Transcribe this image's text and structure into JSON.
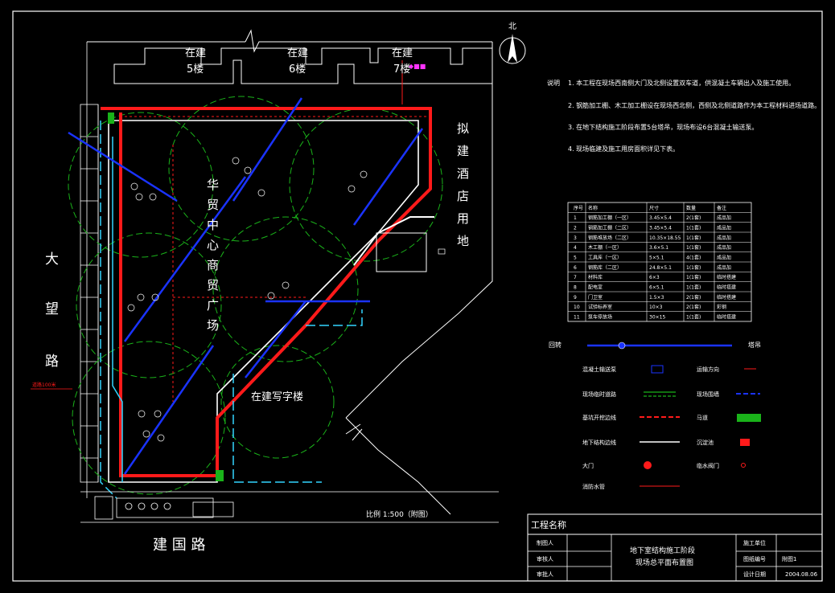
{
  "north_label": "北",
  "labels": {
    "bld5": [
      "在建",
      "5楼"
    ],
    "bld6": [
      "在建",
      "6楼"
    ],
    "bld7": [
      "在建",
      "7楼"
    ],
    "hotel": [
      "拟",
      "建",
      "酒",
      "店",
      "用",
      "地"
    ],
    "plaza": [
      "华",
      "贸",
      "中",
      "心",
      "商",
      "贸",
      "广",
      "场"
    ],
    "wangroad": [
      "大",
      "望",
      "路"
    ],
    "office": "在建写字楼",
    "jianguo": "建 国 路",
    "scale": "比例 1:500（附图）",
    "red_tag": "道路100米"
  },
  "notes": {
    "title": "说明",
    "items": [
      "1. 本工程在现场西南侧大门及北侧设置双车道，供混凝土车辆出入及施工使用。",
      "2. 钢筋加工棚、木工加工棚设在现场西北侧，西侧及北侧道路作为本工程材料进场道路。",
      "3. 在地下结构施工阶段布置5台塔吊，现场布设6台混凝土输送泵。",
      "4. 现场临建及施工用房面积详见下表。"
    ]
  },
  "table": {
    "headers": [
      "序号",
      "名称",
      "尺寸",
      "数量",
      "备注"
    ],
    "rows": [
      [
        "1",
        "钢筋加工棚（一区）",
        "3.45×5.4",
        "2(1套)",
        "成品加"
      ],
      [
        "2",
        "钢筋加工棚（二区）",
        "3.45×5.4",
        "1(1套)",
        "成品加"
      ],
      [
        "3",
        "钢筋堆放场（二区）",
        "10.35×18.55",
        "1(1套)",
        "成品加"
      ],
      [
        "4",
        "木工棚（一区）",
        "3.6×5.1",
        "1(1套)",
        "成品加"
      ],
      [
        "5",
        "工具库（一区）",
        "5×5.1",
        "4(1套)",
        "成品加"
      ],
      [
        "6",
        "钢筋库（二区）",
        "24.8×5.1",
        "1(1套)",
        "成品加"
      ],
      [
        "7",
        "材料库",
        "6×3",
        "1(1套)",
        "临时搭建"
      ],
      [
        "8",
        "配电室",
        "6×5.1",
        "1(1套)",
        "临时搭建"
      ],
      [
        "9",
        "门卫室",
        "1.5×3",
        "2(1套)",
        "临时搭建"
      ],
      [
        "10",
        "试验标养室",
        "10×3",
        "2(1套)",
        "彩钢"
      ],
      [
        "11",
        "泵车停放场",
        "30×15",
        "1(1套)",
        "临时搭建"
      ]
    ]
  },
  "legend": {
    "crane_left": "回转",
    "crane_right": "塔吊",
    "items": [
      {
        "label": "混凝土输送泵"
      },
      {
        "label": "运输方向"
      },
      {
        "label": "现场临时道路"
      },
      {
        "label": "现场围墙"
      },
      {
        "label": "基坑开挖边线"
      },
      {
        "label": "马道"
      },
      {
        "label": "地下结构边线"
      },
      {
        "label": "沉淀池"
      },
      {
        "label": "大门"
      },
      {
        "label": "临水阀门"
      },
      {
        "label": "消防水管"
      }
    ]
  },
  "titleblock": {
    "project_label": "工程名称",
    "rows_left": [
      "制图人",
      "审核人",
      "审批人"
    ],
    "drawing_title": [
      "地下室结构施工阶段",
      "现场总平面布置图"
    ],
    "rows_right": [
      {
        "label": "施工单位",
        "value": ""
      },
      {
        "label": "图纸编号",
        "value": "附图1"
      },
      {
        "label": "设计日期",
        "value": "2004.08.06"
      }
    ]
  },
  "colors": {
    "background": "#000000",
    "red": "#ff1a1a",
    "blue": "#1a33ff",
    "green": "#1ab31a",
    "cyan": "#33d6ff",
    "white": "#ffffff",
    "magenta": "#ff33ff"
  }
}
